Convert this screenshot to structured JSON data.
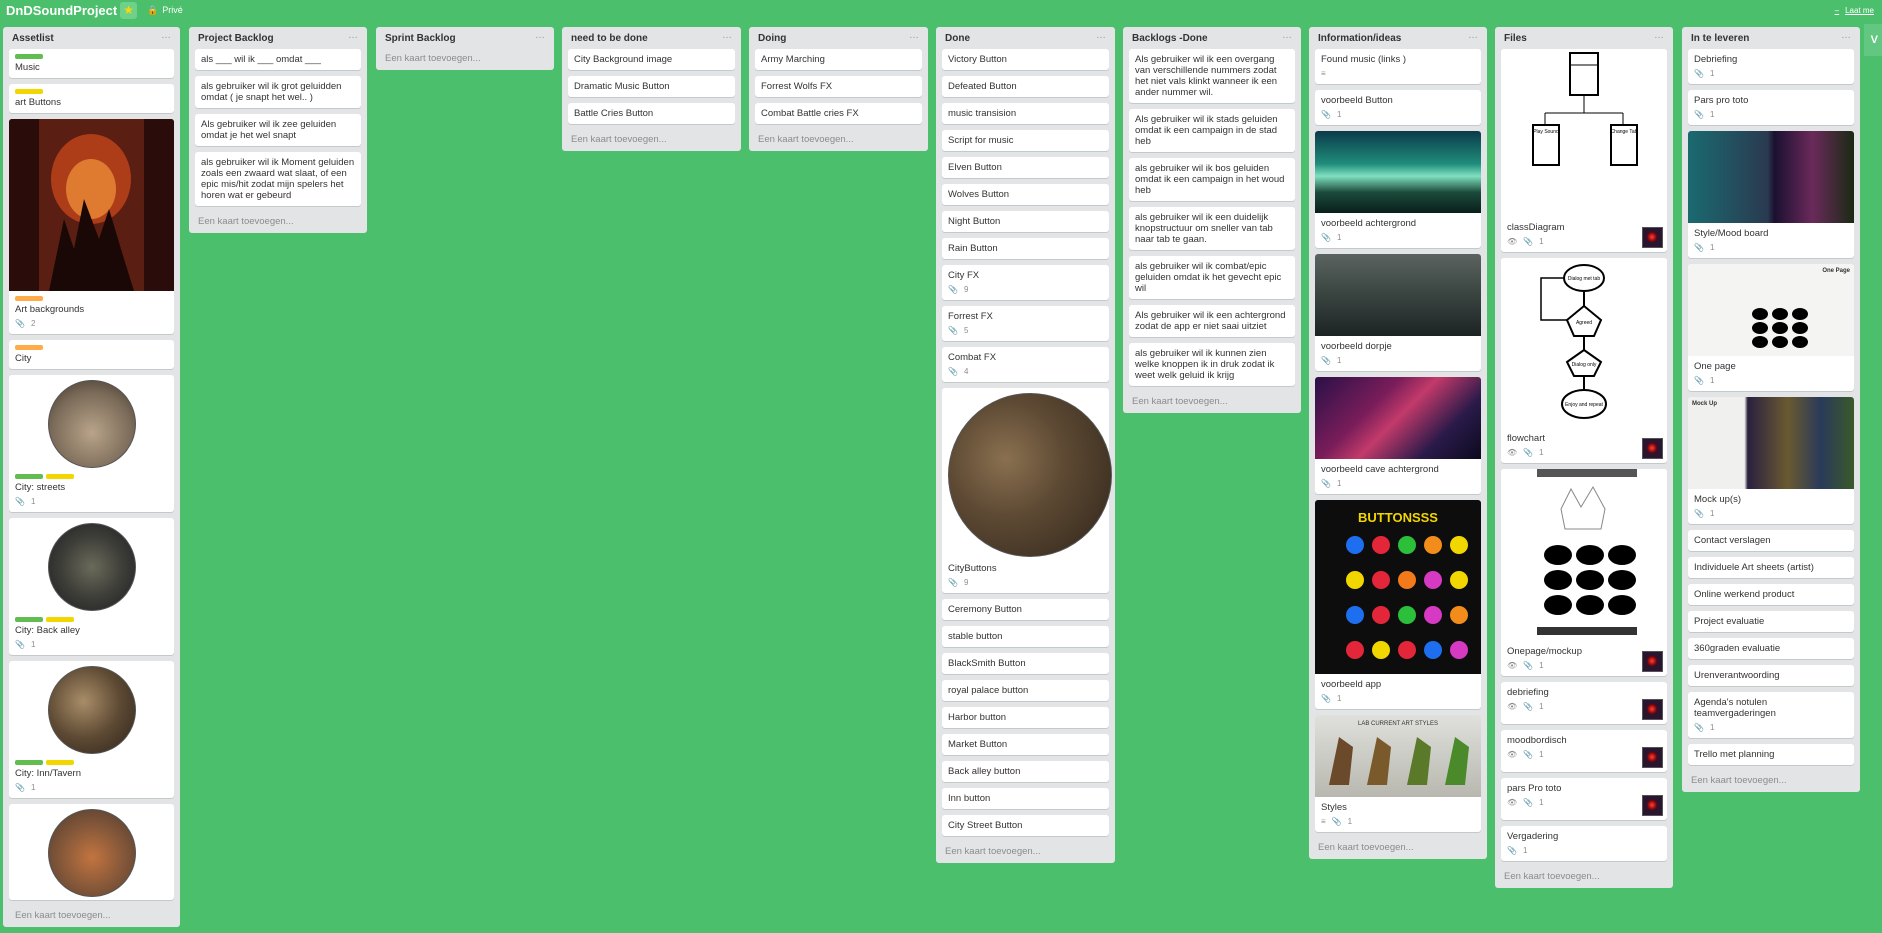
{
  "board": {
    "title": "DnDSoundProject",
    "star": "★",
    "visibility": "Privé",
    "right_link": "Laat me"
  },
  "side_button": "V",
  "lists": {
    "assetlist": {
      "title": "Assetlist",
      "cards": {
        "music": "Music",
        "art_buttons": "art Buttons",
        "art_backgrounds": "Art backgrounds",
        "art_backgrounds_count": "2",
        "city": "City",
        "city_streets": "City: streets",
        "city_streets_count": "1",
        "city_back_alley": "City: Back alley",
        "city_back_alley_count": "1",
        "city_inn": "City: Inn/Tavern",
        "city_inn_count": "1"
      },
      "add": "Een kaart toevoegen..."
    },
    "project_backlog": {
      "title": "Project Backlog",
      "cards": [
        "als ___ wil ik ___ omdat ___",
        "als gebruiker wil ik grot geluidden omdat ( je snapt het wel.. )",
        "Als gebruiker wil ik zee geluiden omdat je het wel snapt",
        "als gebruiker wil ik Moment geluiden zoals een zwaard wat slaat, of een epic mis/hit zodat mijn spelers het horen wat er gebeurd"
      ],
      "add": "Een kaart toevoegen..."
    },
    "sprint_backlog": {
      "title": "Sprint Backlog",
      "add": "Een kaart toevoegen..."
    },
    "need_to_be_done": {
      "title": "need to be done",
      "cards": [
        "City Background image",
        "Dramatic Music Button",
        "Battle Cries Button"
      ],
      "add": "Een kaart toevoegen..."
    },
    "doing": {
      "title": "Doing",
      "cards": [
        "Army Marching",
        "Forrest Wolfs FX",
        "Combat Battle cries FX"
      ],
      "add": "Een kaart toevoegen..."
    },
    "done": {
      "title": "Done",
      "top_cards": [
        "Victory Button",
        "Defeated Button",
        "music transision",
        "Script for music",
        "Elven Button",
        "Wolves Button",
        "Night Button",
        "Rain Button"
      ],
      "city_fx": "City FX",
      "city_fx_count": "9",
      "forrest_fx": "Forrest FX",
      "forrest_fx_count": "5",
      "combat_fx": "Combat FX",
      "combat_fx_count": "4",
      "city_buttons": "CityButtons",
      "city_buttons_count": "9",
      "bottom_cards": [
        "Ceremony Button",
        "stable button",
        "BlackSmith Button",
        "royal palace button",
        "Harbor button",
        "Market Button",
        "Back alley button",
        "Inn button",
        "City Street Button"
      ],
      "add": "Een kaart toevoegen..."
    },
    "backlogs_done": {
      "title": "Backlogs -Done",
      "cards": [
        "Als gebruiker wil ik een overgang van verschillende nummers zodat het niet vals klinkt wanneer ik een ander nummer wil.",
        "Als gebruiker wil ik stads geluiden omdat ik een campaign in de stad heb",
        "als gebruiker wil ik bos geluiden omdat ik een campaign in het woud heb",
        "als gebruiker wil ik een duidelijk knopstructuur om sneller van tab naar tab te gaan.",
        "als gebruiker wil ik combat/epic geluiden omdat ik het gevecht epic wil",
        "Als gebruiker wil ik een achtergrond zodat de app er niet saai uitziet",
        "als gebruiker wil ik kunnen zien welke knoppen ik in druk zodat ik weet welk geluid ik krijg"
      ],
      "add": "Een kaart toevoegen..."
    },
    "information": {
      "title": "Information/ideas",
      "found_music": "Found music (links )",
      "voorbeeld_button": "voorbeeld Button",
      "voorbeeld_button_count": "1",
      "achtergrond": "voorbeeld achtergrond",
      "achtergrond_count": "1",
      "dorpje": "voorbeeld dorpje",
      "dorpje_count": "1",
      "cave": "voorbeeld cave achtergrond",
      "cave_count": "1",
      "app_title": "BUTTONSSS",
      "app": "voorbeeld app",
      "app_count": "1",
      "styles_title": "LAB CURRENT ART STYLES",
      "styles": "Styles",
      "styles_count": "1",
      "add": "Een kaart toevoegen..."
    },
    "files": {
      "title": "Files",
      "class_diagram": "classDiagram",
      "uml_play": "Play Sound",
      "uml_change": "Change Tab",
      "flow_start": "Dialog met tab",
      "flow_mid": "Agreed",
      "flow_mid2": "Dialog only",
      "flow_end": "Enjoy and repeat",
      "flowchart": "flowchart",
      "onepage": "Onepage/mockup",
      "debriefing": "debriefing",
      "moodbord": "moodbordisch",
      "pars": "pars Pro toto",
      "vergadering": "Vergadering",
      "count": "1",
      "add": "Een kaart toevoegen..."
    },
    "in_te_leveren": {
      "title": "In te leveren",
      "debriefing": "Debriefing",
      "pars": "Pars pro toto",
      "style": "Style/Mood board",
      "onepage": "One page",
      "onepage_heading": "One Page",
      "mockup": "Mock up(s)",
      "mockup_heading": "Mock Up",
      "agenda": "Agenda's notulen teamvergaderingen",
      "count": "1",
      "simple_cards": [
        "Contact verslagen",
        "Individuele Art sheets (artist)",
        "Online werkend product",
        "Project evaluatie",
        "360graden evaluatie",
        "Urenverantwoording"
      ],
      "last": "Trello met planning",
      "add": "Een kaart toevoegen..."
    }
  },
  "icons": {
    "menu": "…",
    "attachment": "attachment-icon",
    "eye": "eye-icon",
    "description": "description-icon"
  }
}
